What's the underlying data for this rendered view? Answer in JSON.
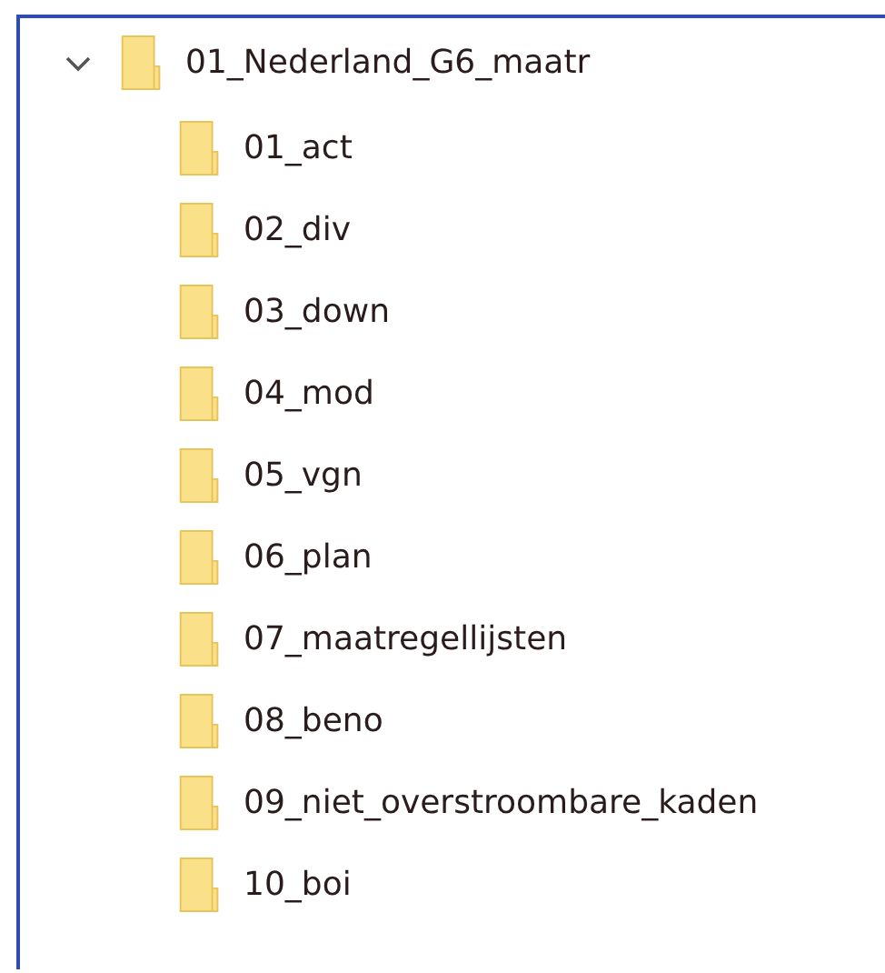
{
  "tree": [
    {
      "name": "01_Nederland_G6_maatr",
      "expanded": true,
      "children": [
        {
          "name": "01_act"
        },
        {
          "name": "02_div"
        },
        {
          "name": "03_down"
        },
        {
          "name": "04_mod"
        },
        {
          "name": "05_vgn"
        },
        {
          "name": "06_plan"
        },
        {
          "name": "07_maatregellijsten"
        },
        {
          "name": "08_beno"
        },
        {
          "name": "09_niet_overstroombare_kaden"
        },
        {
          "name": "10_boi"
        }
      ]
    }
  ]
}
